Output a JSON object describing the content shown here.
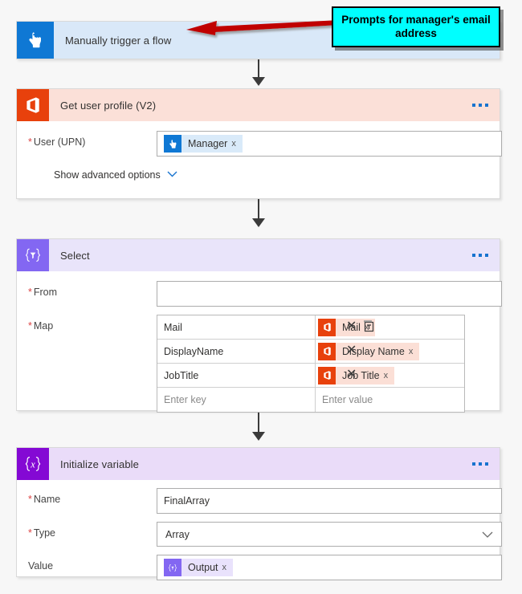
{
  "canvas": {
    "background_color": "#f7f7f7"
  },
  "callout": {
    "text": "Prompts for manager's email address",
    "background_color": "#00ffff",
    "border_color": "#000000",
    "arrow_color": "#c00000"
  },
  "cards": [
    {
      "id": "trigger",
      "title": "Manually trigger a flow",
      "icon": "tap-hand-icon",
      "icon_color": "#0f78d4",
      "header_color": "#d9e8f8",
      "has_menu": false,
      "collapsed": true
    },
    {
      "id": "get-user-profile",
      "title": "Get user profile (V2)",
      "icon": "office365-icon",
      "icon_color": "#e8410c",
      "header_color": "#fbe0d8",
      "has_menu": true,
      "menu_label": "...",
      "fields": [
        {
          "label": "User (UPN)",
          "required": true,
          "token": {
            "text": "Manager",
            "icon": "tap-hand-icon",
            "theme": "blue",
            "remove_label": "x"
          }
        }
      ],
      "advanced_link": "Show advanced options"
    },
    {
      "id": "select",
      "title": "Select",
      "icon": "select-braces-icon",
      "icon_color": "#8367f2",
      "header_color": "#e9e4fa",
      "has_menu": true,
      "menu_label": "...",
      "fields": [
        {
          "label": "From",
          "required": true,
          "value": ""
        },
        {
          "label": "Map",
          "required": true
        }
      ],
      "map_rows": [
        {
          "key": "Mail",
          "value_token": {
            "text": "Mail",
            "icon": "office365-icon",
            "theme": "orange",
            "remove_label": "x"
          },
          "delete_label": "✕",
          "has_text_mode_icon": true
        },
        {
          "key": "DisplayName",
          "value_token": {
            "text": "Display Name",
            "icon": "office365-icon",
            "theme": "orange",
            "remove_label": "x"
          },
          "delete_label": "✕",
          "has_text_mode_icon": false
        },
        {
          "key": "JobTitle",
          "value_token": {
            "text": "Job Title",
            "icon": "office365-icon",
            "theme": "orange",
            "remove_label": "x"
          },
          "delete_label": "✕",
          "has_text_mode_icon": false
        },
        {
          "key_placeholder": "Enter key",
          "value_placeholder": "Enter value",
          "delete_label": "",
          "has_text_mode_icon": false
        }
      ]
    },
    {
      "id": "initialize-variable",
      "title": "Initialize variable",
      "icon": "variable-braces-x-icon",
      "icon_color": "#8409d4",
      "header_color": "#eadcf9",
      "has_menu": true,
      "menu_label": "...",
      "fields": [
        {
          "label": "Name",
          "required": true,
          "value": "FinalArray"
        },
        {
          "label": "Type",
          "required": true,
          "value": "Array",
          "control": "dropdown",
          "chevron": "∨"
        },
        {
          "label": "Value",
          "required": false,
          "token": {
            "text": "Output",
            "icon": "select-braces-icon",
            "theme": "purple",
            "remove_label": "x"
          }
        }
      ]
    }
  ]
}
